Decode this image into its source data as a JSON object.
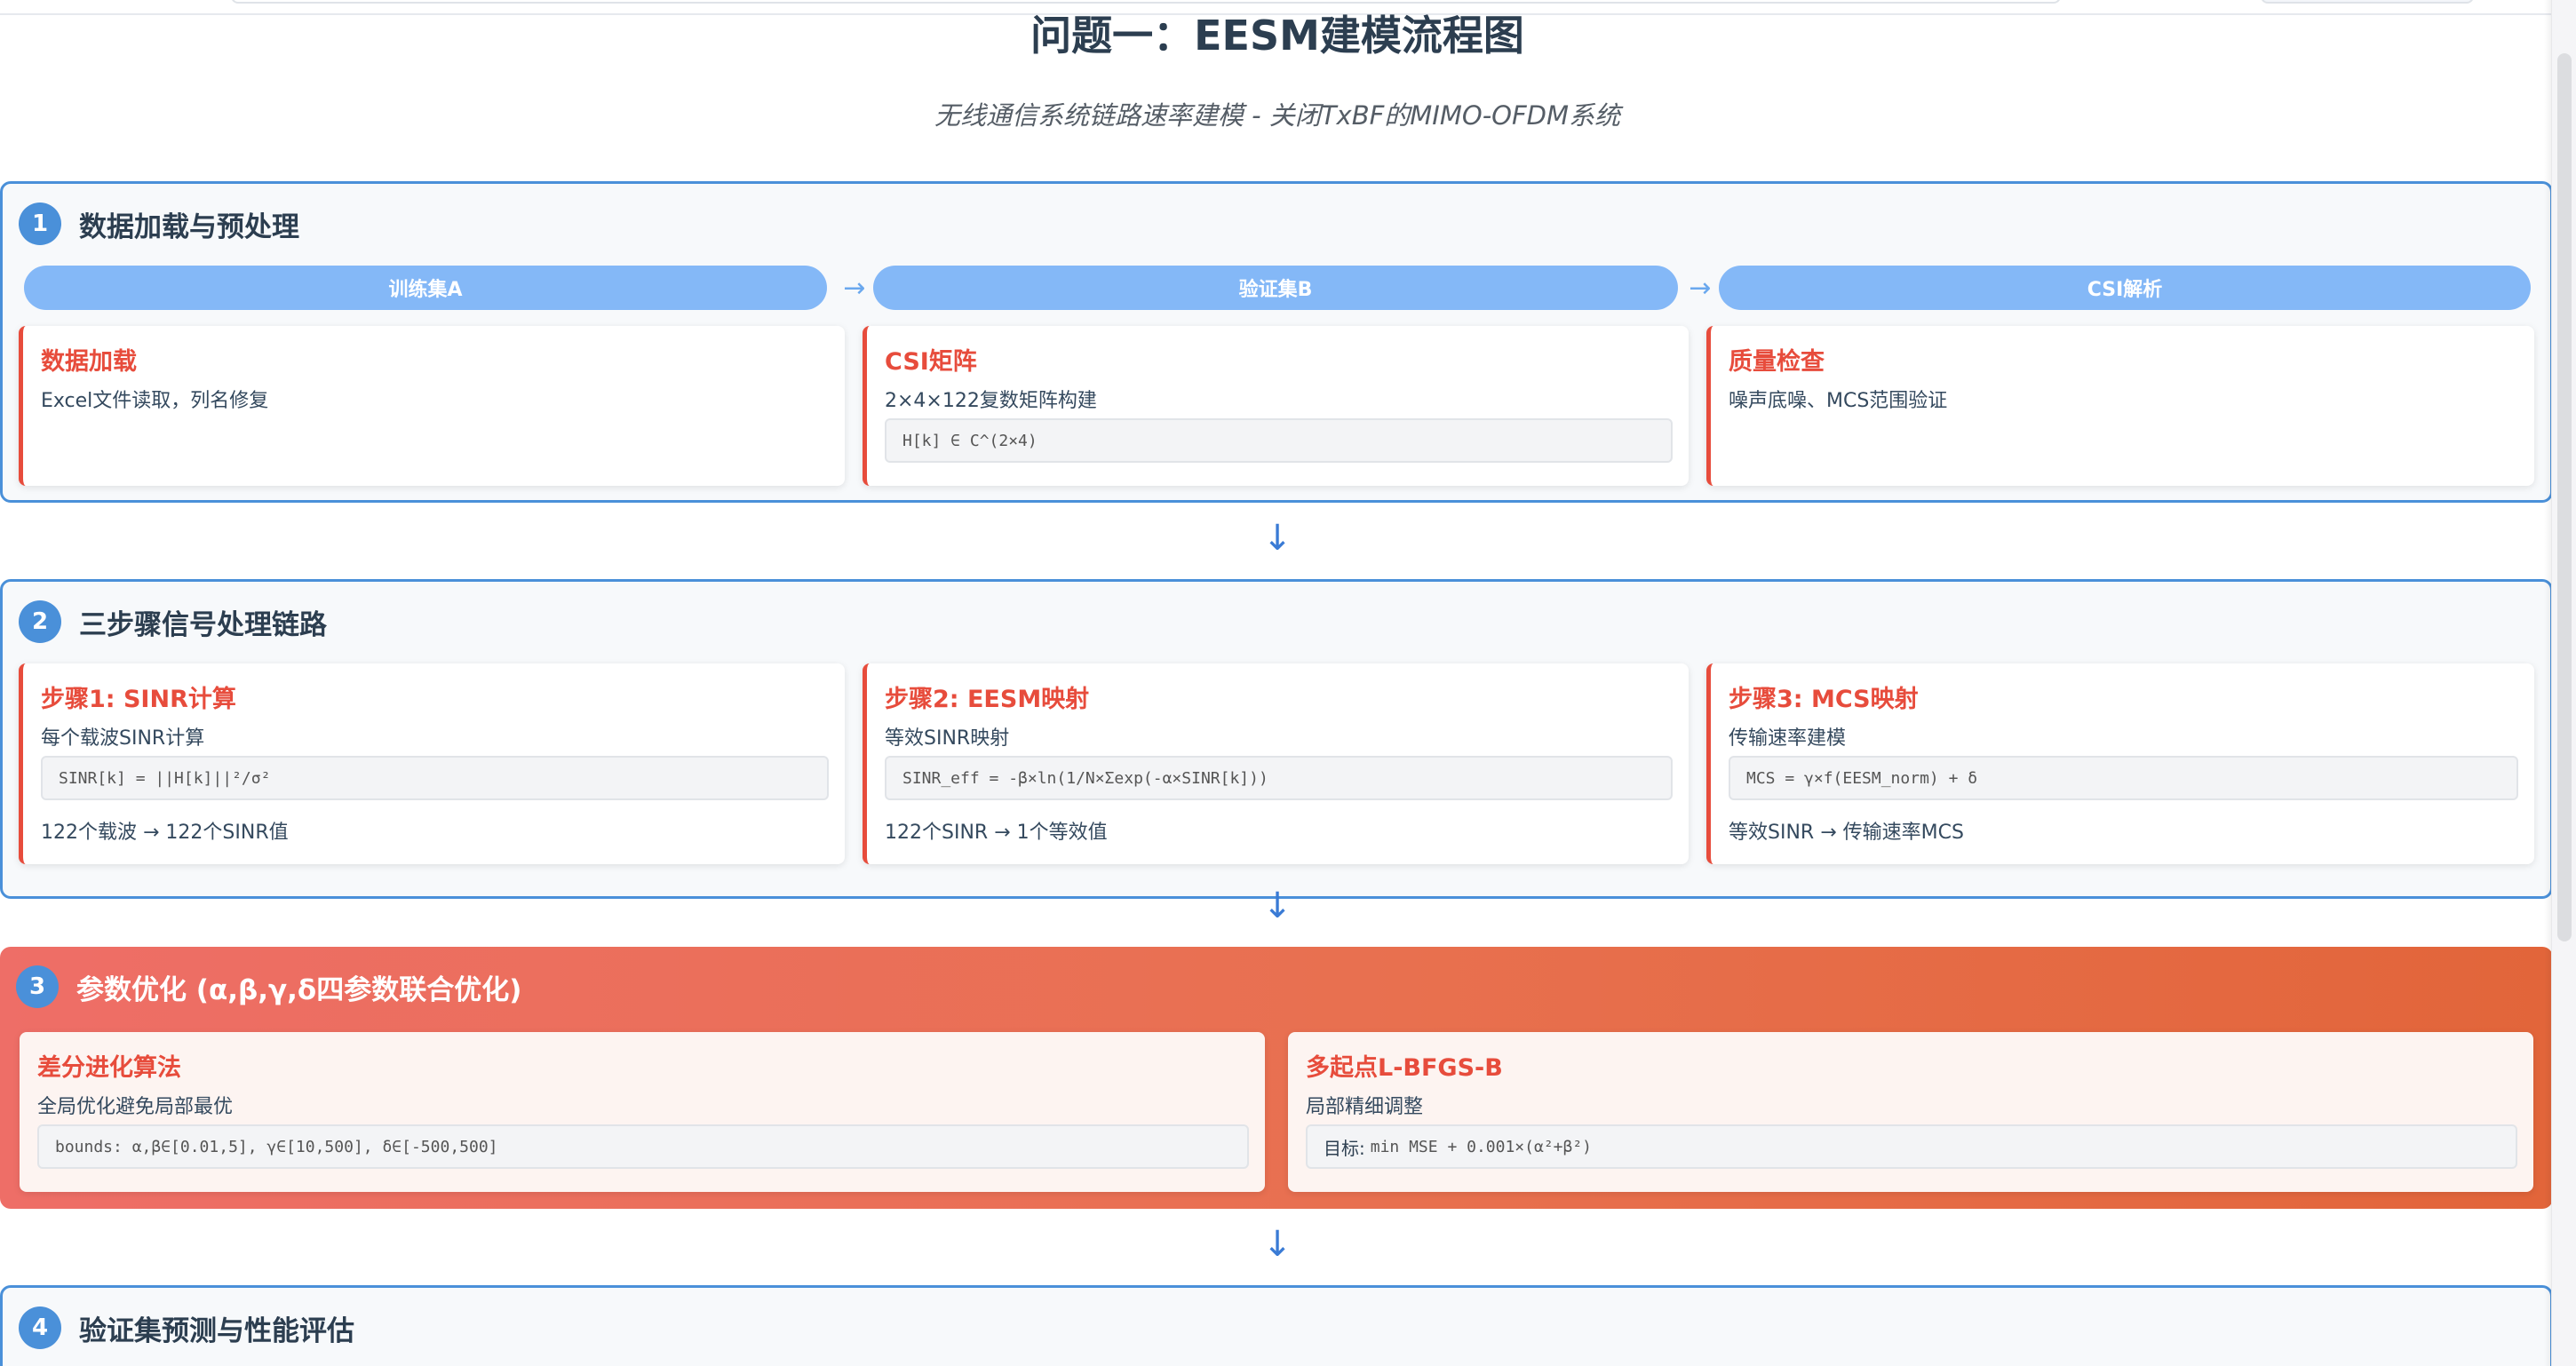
{
  "title": "问题一：EESM建模流程图",
  "subtitle": "无线通信系统链路速率建模 - 关闭TxBF的MIMO-OFDM系统",
  "flow_arrow": "↓",
  "section1": {
    "number": "1",
    "title": "数据加载与预处理",
    "pills": [
      "训练集A",
      "验证集B",
      "CSI解析"
    ],
    "pill_arrow": "→",
    "cards": [
      {
        "title": "数据加载",
        "desc": "Excel文件读取，列名修复"
      },
      {
        "title": "CSI矩阵",
        "desc": "2×4×122复数矩阵构建",
        "formula": "H[k] ∈ C^(2×4)"
      },
      {
        "title": "质量检查",
        "desc": "噪声底噪、MCS范围验证"
      }
    ]
  },
  "section2": {
    "number": "2",
    "title": "三步骤信号处理链路",
    "cards": [
      {
        "title": "步骤1: SINR计算",
        "desc": "每个载波SINR计算",
        "formula": "SINR[k] = ||H[k]||²/σ²",
        "foot": "122个载波 → 122个SINR值"
      },
      {
        "title": "步骤2: EESM映射",
        "desc": "等效SINR映射",
        "formula": "SINR_eff = -β×ln(1/N×Σexp(-α×SINR[k]))",
        "foot": "122个SINR → 1个等效值"
      },
      {
        "title": "步骤3: MCS映射",
        "desc": "传输速率建模",
        "formula": "MCS = γ×f(EESM_norm) + δ",
        "foot": "等效SINR → 传输速率MCS"
      }
    ]
  },
  "section3": {
    "number": "3",
    "title": "参数优化 (α,β,γ,δ四参数联合优化)",
    "cards": [
      {
        "title": "差分进化算法",
        "desc": "全局优化避免局部最优",
        "formula": "bounds: α,β∈[0.01,5], γ∈[10,500], δ∈[-500,500]"
      },
      {
        "title": "多起点L-BFGS-B",
        "desc": "局部精细调整",
        "formula_label": "目标:",
        "formula": "min MSE + 0.001×(α²+β²)"
      }
    ]
  },
  "section4": {
    "number": "4",
    "title": "验证集预测与性能评估"
  },
  "colors": {
    "accent_blue": "#4a90d9",
    "pill_blue": "#84b8f7",
    "card_title_red": "#e74c3c",
    "section3_gradient_start": "#ee6e67",
    "section3_gradient_end": "#e2653a"
  }
}
